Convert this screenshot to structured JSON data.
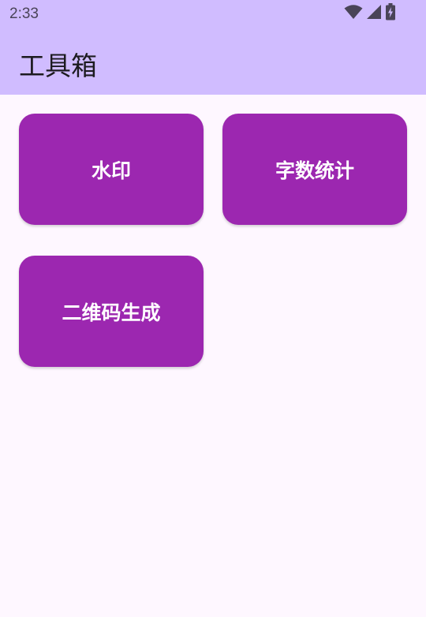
{
  "status_bar": {
    "time": "2:33",
    "icons": [
      "wifi-icon",
      "cellular-signal-icon",
      "battery-charging-icon"
    ]
  },
  "app_bar": {
    "title": "工具箱"
  },
  "tools": [
    {
      "label": "水印"
    },
    {
      "label": "字数统计"
    },
    {
      "label": "二维码生成"
    }
  ],
  "colors": {
    "app_bar_bg": "#d0bcff",
    "page_bg": "#fef7ff",
    "tile_bg": "#9c27b0",
    "tile_text": "#ffffff",
    "status_icon": "#4a4458"
  }
}
